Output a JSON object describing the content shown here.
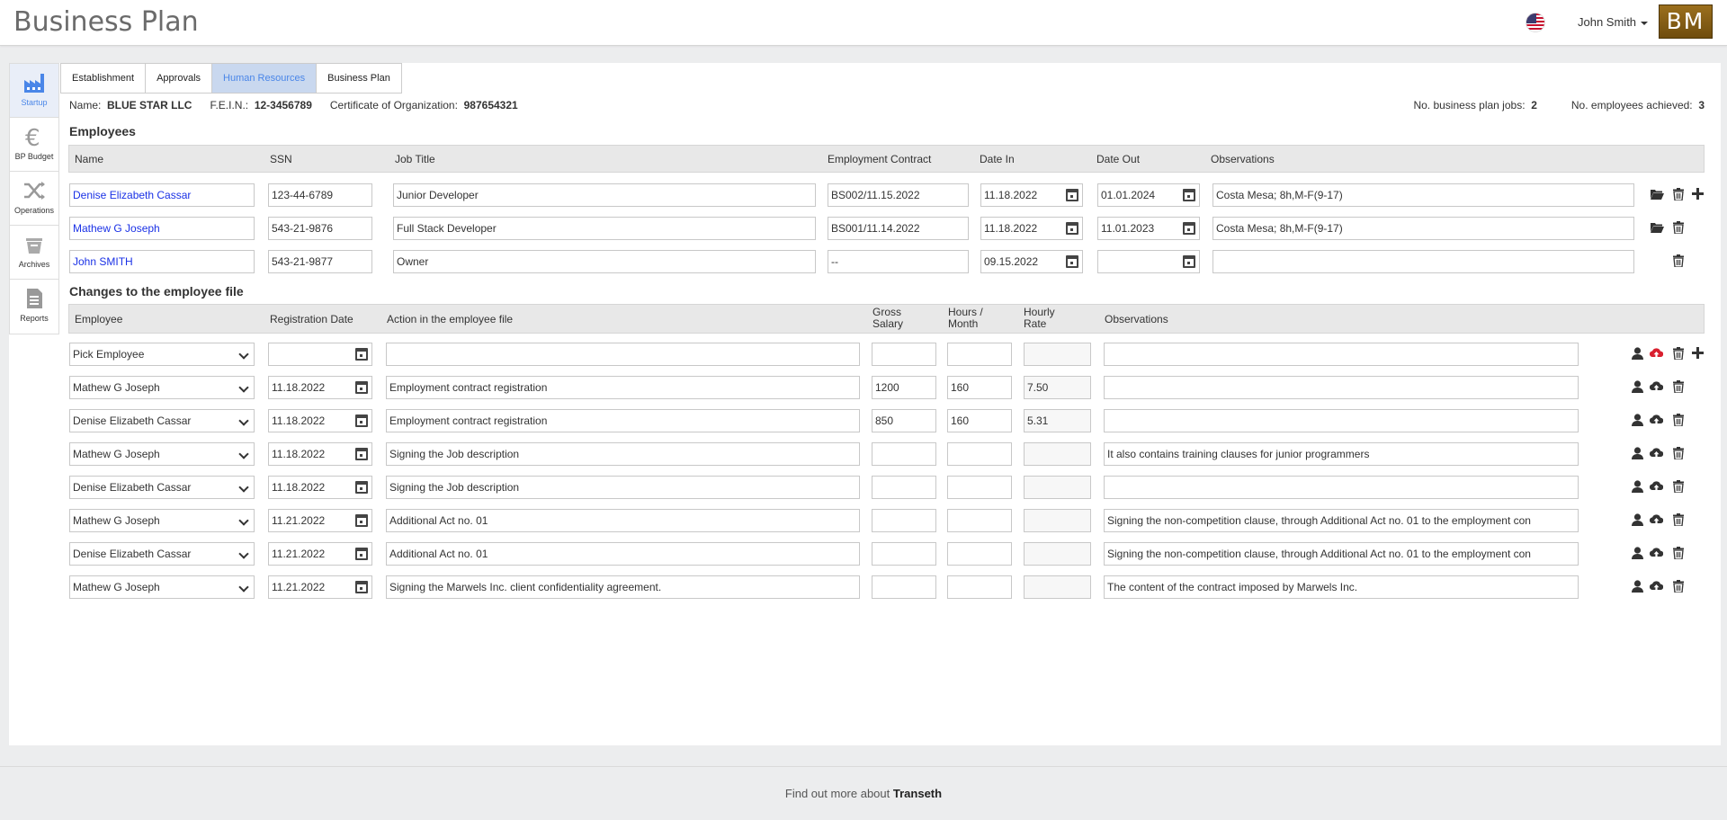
{
  "app": {
    "title": "Business Plan",
    "logo_text": "BM"
  },
  "user": {
    "name": "John Smith"
  },
  "sidebar": {
    "items": [
      {
        "label": "Startup",
        "icon": "factory-icon"
      },
      {
        "label": "BP Budget",
        "icon": "euro-icon"
      },
      {
        "label": "Operations",
        "icon": "shuffle-icon"
      },
      {
        "label": "Archives",
        "icon": "basket-icon"
      },
      {
        "label": "Reports",
        "icon": "report-icon"
      }
    ]
  },
  "tabs": [
    "Establishment",
    "Approvals",
    "Human Resources",
    "Business Plan"
  ],
  "company": {
    "name_label": "Name:",
    "name": "BLUE STAR LLC",
    "fein_label": "F.E.I.N.:",
    "fein": "12-3456789",
    "cert_label": "Certificate of Organization:",
    "cert": "987654321",
    "bp_jobs_label": "No. business plan jobs:",
    "bp_jobs": "2",
    "achieved_label": "No. employees achieved:",
    "achieved": "3"
  },
  "employees": {
    "title": "Employees",
    "headers": [
      "Name",
      "SSN",
      "Job Title",
      "Employment Contract",
      "Date In",
      "Date Out",
      "Observations"
    ],
    "rows": [
      {
        "name": "Denise Elizabeth Cassar",
        "ssn": "123-44-6789",
        "job": "Junior Developer",
        "contract": "BS002/11.15.2022",
        "date_in": "11.18.2022",
        "date_out": "01.01.2024",
        "obs": "Costa Mesa; 8h,M-F(9-17)"
      },
      {
        "name": "Mathew G Joseph",
        "ssn": "543-21-9876",
        "job": "Full Stack Developer",
        "contract": "BS001/11.14.2022",
        "date_in": "11.18.2022",
        "date_out": "11.01.2023",
        "obs": "Costa Mesa; 8h,M-F(9-17)"
      },
      {
        "name": "John SMITH",
        "ssn": "543-21-9877",
        "job": "Owner",
        "contract": "--",
        "date_in": "09.15.2022",
        "date_out": "",
        "obs": ""
      }
    ]
  },
  "changes": {
    "title": "Changes to the employee file",
    "headers": {
      "employee": "Employee",
      "reg_date": "Registration Date",
      "action": "Action in the employee file",
      "gross1": "Gross",
      "gross2": "Salary",
      "hours1": "Hours /",
      "hours2": "Month",
      "rate1": "Hourly",
      "rate2": "Rate",
      "obs": "Observations"
    },
    "rows": [
      {
        "employee": "Pick Employee",
        "date": "",
        "action": "",
        "gross": "",
        "hours": "",
        "rate": "",
        "obs": ""
      },
      {
        "employee": "Mathew G Joseph",
        "date": "11.18.2022",
        "action": "Employment contract registration",
        "gross": "1200",
        "hours": "160",
        "rate": "7.50",
        "obs": ""
      },
      {
        "employee": "Denise Elizabeth Cassar",
        "date": "11.18.2022",
        "action": "Employment contract registration",
        "gross": "850",
        "hours": "160",
        "rate": "5.31",
        "obs": ""
      },
      {
        "employee": "Mathew G Joseph",
        "date": "11.18.2022",
        "action": "Signing the Job description",
        "gross": "",
        "hours": "",
        "rate": "",
        "obs": "It also contains training clauses for junior programmers"
      },
      {
        "employee": "Denise Elizabeth Cassar",
        "date": "11.18.2022",
        "action": "Signing the Job description",
        "gross": "",
        "hours": "",
        "rate": "",
        "obs": ""
      },
      {
        "employee": "Mathew G Joseph",
        "date": "11.21.2022",
        "action": "Additional Act no. 01",
        "gross": "",
        "hours": "",
        "rate": "",
        "obs": "Signing the non-competition clause, through Additional Act no. 01 to the employment con"
      },
      {
        "employee": "Denise Elizabeth Cassar",
        "date": "11.21.2022",
        "action": "Additional Act no. 01",
        "gross": "",
        "hours": "",
        "rate": "",
        "obs": "Signing the non-competition clause, through Additional Act no. 01 to the employment con"
      },
      {
        "employee": "Mathew G Joseph",
        "date": "11.21.2022",
        "action": "Signing the Marwels Inc. client confidentiality agreement.",
        "gross": "",
        "hours": "",
        "rate": "",
        "obs": "The content of the contract imposed by Marwels Inc."
      }
    ]
  },
  "footer": {
    "text": "Find out more about",
    "brand": "Transeth"
  },
  "colors": {
    "link": "#1a31e6",
    "accent": "#4a86e8",
    "upload_active": "#d9202f"
  }
}
